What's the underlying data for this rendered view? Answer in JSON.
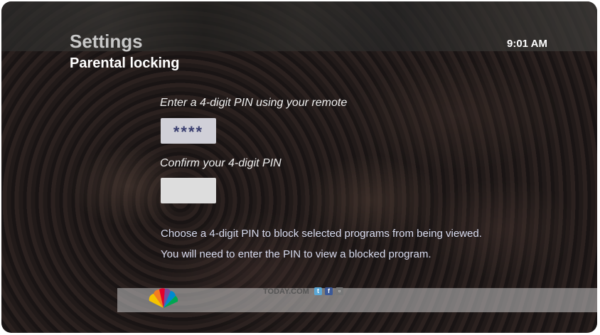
{
  "header": {
    "title": "Settings",
    "subtitle": "Parental locking",
    "time": "9:01 AM"
  },
  "form": {
    "enter_label": "Enter a 4-digit PIN using your remote",
    "enter_value": "****",
    "confirm_label": "Confirm your 4-digit PIN",
    "confirm_value": ""
  },
  "info": {
    "line1": "Choose a 4-digit PIN to block selected programs from being viewed.",
    "line2": "You will need to enter the PIN to view a blocked program."
  },
  "ticker": {
    "site": "TODAY.COM",
    "icons": [
      "nbc-peacock-icon",
      "twitter-icon",
      "facebook-icon",
      "instagram-icon"
    ]
  }
}
